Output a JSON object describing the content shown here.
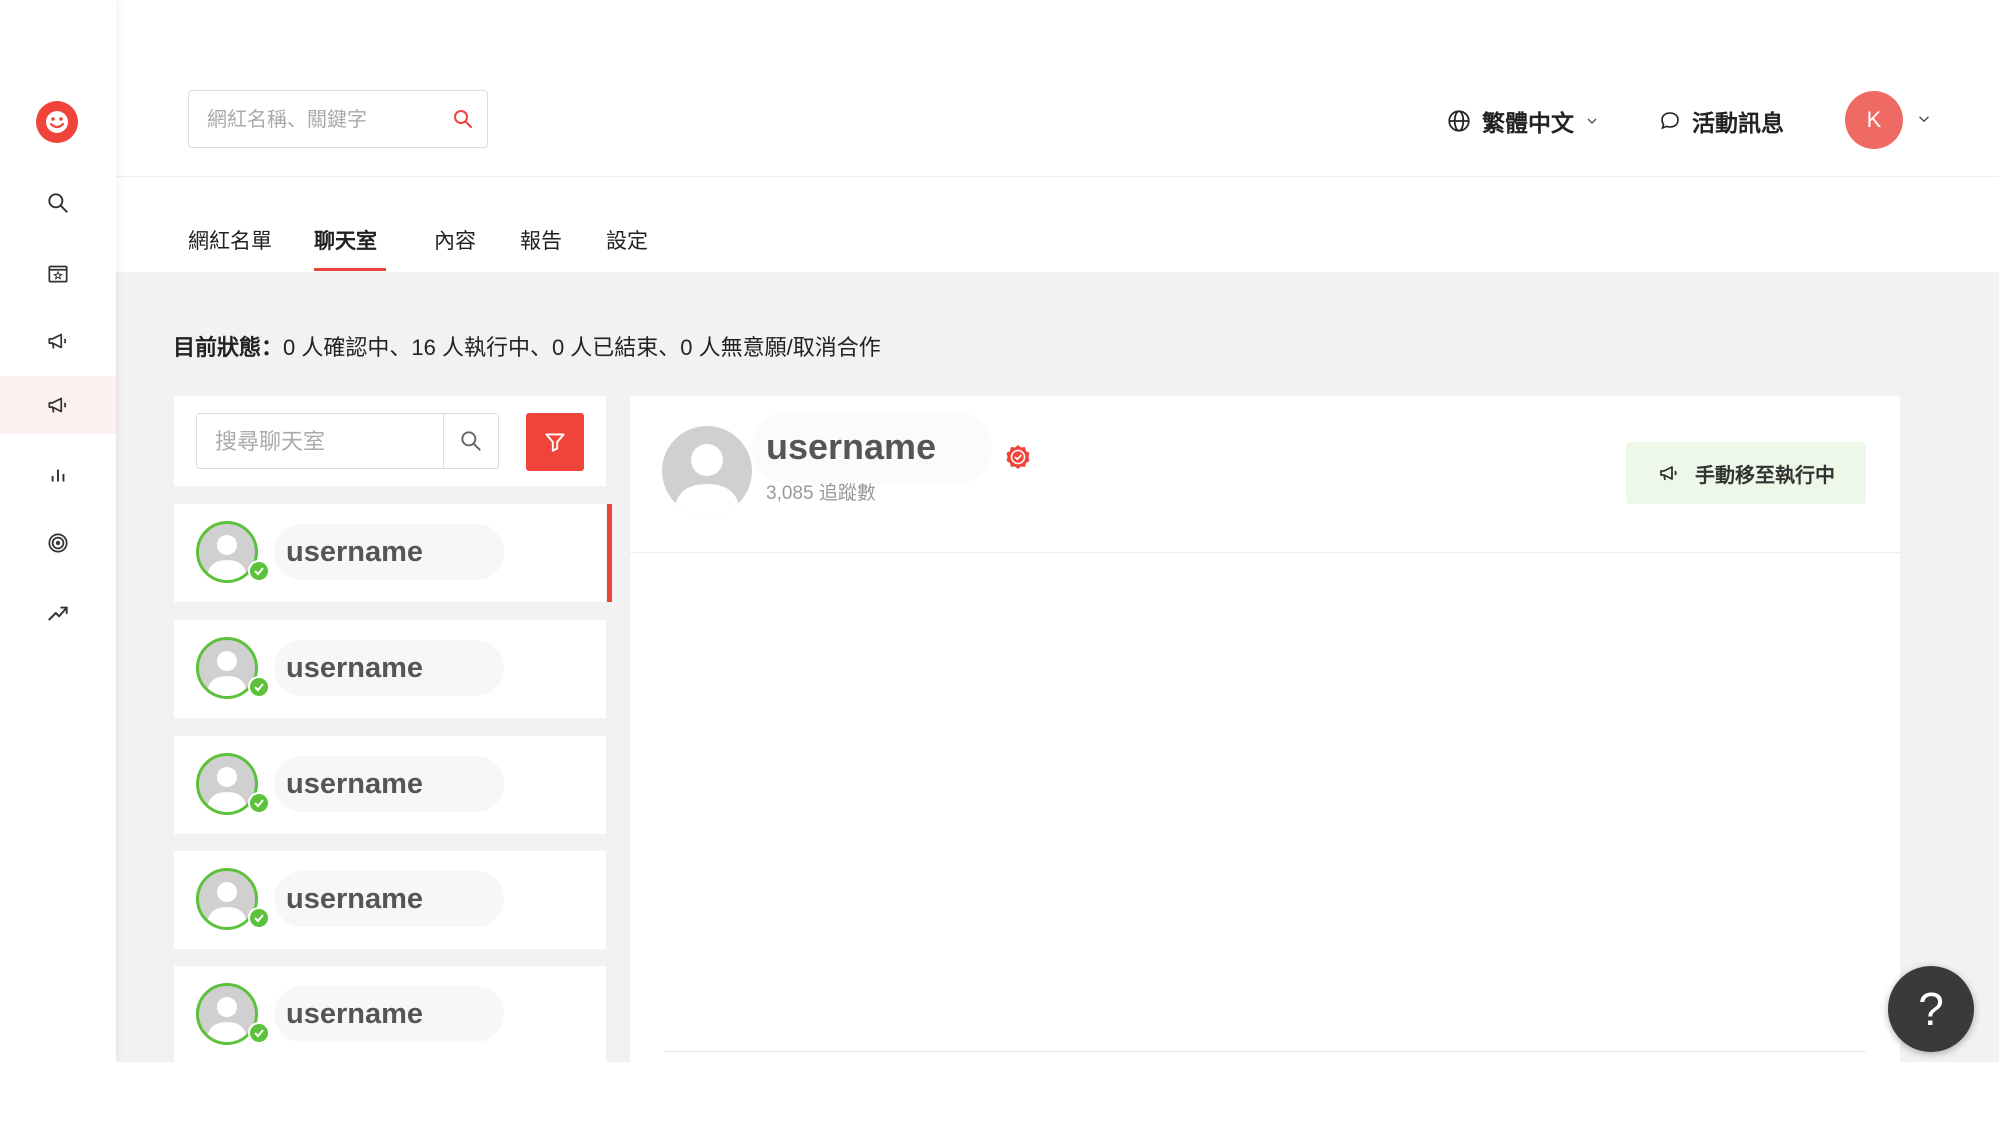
{
  "header": {
    "search_placeholder": "網紅名稱、關鍵字",
    "language": "繁體中文",
    "messages": "活動訊息",
    "avatar_initial": "K"
  },
  "sidebar": {
    "items": [
      {
        "icon": "search-icon"
      },
      {
        "icon": "store-star-icon"
      },
      {
        "icon": "megaphone-icon"
      },
      {
        "icon": "megaphone-icon",
        "active": true
      },
      {
        "icon": "bar-chart-icon"
      },
      {
        "icon": "target-icon"
      },
      {
        "icon": "trend-up-icon"
      }
    ]
  },
  "tabs": [
    {
      "label": "網紅名單"
    },
    {
      "label": "聊天室",
      "active": true
    },
    {
      "label": "內容"
    },
    {
      "label": "報告"
    },
    {
      "label": "設定"
    }
  ],
  "status": {
    "label": "目前狀態：",
    "text": "0 人確認中、16 人執行中、0 人已結束、0 人無意願/取消合作"
  },
  "chat_list": {
    "search_placeholder": "搜尋聊天室",
    "items": [
      {
        "name": "username"
      },
      {
        "name": "username"
      },
      {
        "name": "username"
      },
      {
        "name": "username"
      },
      {
        "name": "username"
      }
    ]
  },
  "detail": {
    "name": "username",
    "followers": "3,085 追蹤數",
    "action_button": "手動移至執行中"
  },
  "help": {
    "label": "?"
  },
  "colors": {
    "accent": "#f0443a",
    "success": "#5cc23b",
    "action_bg": "#eef8e8"
  }
}
